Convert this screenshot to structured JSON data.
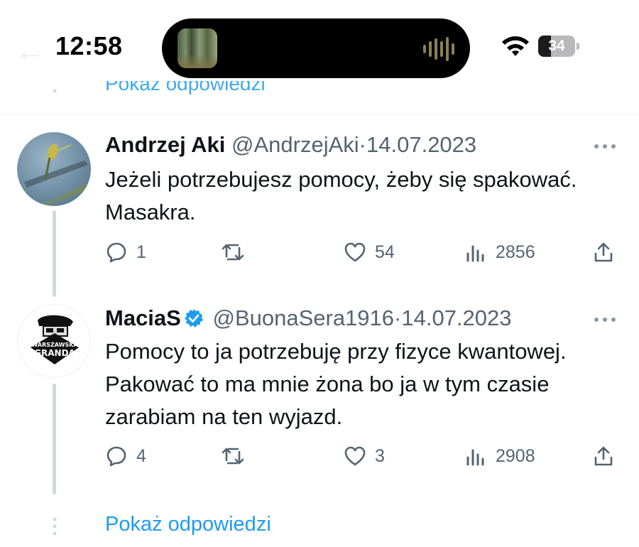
{
  "status_bar": {
    "time": "12:58",
    "battery_level": "34",
    "battery_fraction": 0.34,
    "icons": [
      "wifi-icon",
      "battery-icon",
      "audio-wave-icon"
    ]
  },
  "previous_reply": {
    "show_replies_label": "Pokaż odpowiedzi"
  },
  "tweets": [
    {
      "display_name": "Andrzej Aki",
      "handle": "@AndrzejAki",
      "separator": "·",
      "date": "14.07.2023",
      "verified": false,
      "text": "Jeżeli potrzebujesz pomocy, żeby się spakować. Masakra.",
      "replies": "1",
      "retweets": "",
      "likes": "54",
      "views": "2856"
    },
    {
      "display_name": "MaciaS",
      "handle": "@BuonaSera1916",
      "separator": "·",
      "date": "14.07.2023",
      "verified": true,
      "avatar_text": {
        "top": "WARSZAWSKA",
        "bottom": "GRANDA"
      },
      "text": "Pomocy to ja potrzebuję przy fizyce kwantowej. Pakować to ma mnie żona bo ja w tym czasie zarabiam na ten wyjazd.",
      "replies": "4",
      "retweets": "",
      "likes": "3",
      "views": "2908"
    }
  ],
  "show_replies_label": "Pokaż odpowiedzi",
  "colors": {
    "link": "#1d9bf0",
    "secondary_text": "#536471",
    "thread_line": "#cfd9de",
    "verified": "#1d9bf0"
  }
}
